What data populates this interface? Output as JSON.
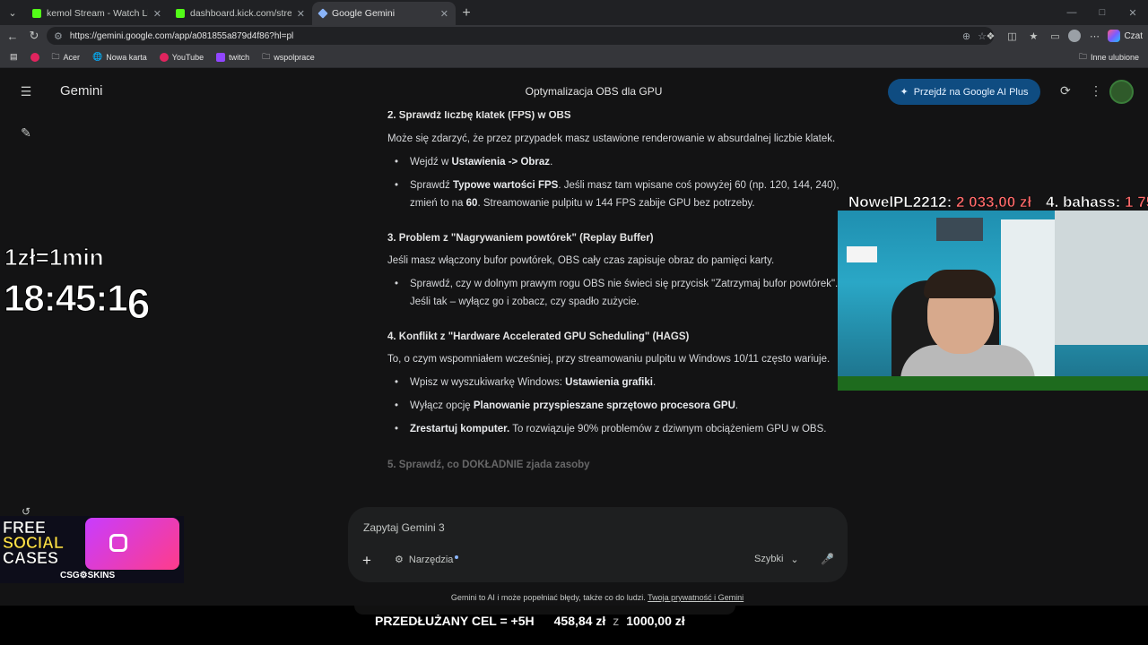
{
  "browser": {
    "tabs": [
      {
        "title": "kemol Stream - Watch Live on Kick",
        "favicon_color": "#53fc18"
      },
      {
        "title": "dashboard.kick.com/stream",
        "favicon_color": "#53fc18"
      },
      {
        "title": "Google Gemini",
        "favicon_color": "#8ab4f8"
      }
    ],
    "url": "https://gemini.google.com/app/a081855a879d4f86?hl=pl",
    "czat_label": "Czat",
    "bookmarks": [
      "Acer",
      "Nowa karta",
      "YouTube",
      "twitch",
      "wspolprace"
    ],
    "other_bookmarks": "Inne ulubione"
  },
  "gemini": {
    "brand": "Gemini",
    "chat_title": "Optymalizacja OBS dla GPU",
    "upgrade_label": "Przejdź na Google AI Plus",
    "content": {
      "sec2_title": "2. Sprawdź liczbę klatek (FPS) w OBS",
      "sec2_intro": "Może się zdarzyć, że przez przypadek masz ustawione renderowanie w absurdalnej liczbie klatek.",
      "sec2_b1_pre": "Wejdź w ",
      "sec2_b1_bold": "Ustawienia -> Obraz",
      "sec2_b1_post": ".",
      "sec2_b2_pre": "Sprawdź ",
      "sec2_b2_bold": "Typowe wartości FPS",
      "sec2_b2_mid": ". Jeśli masz tam wpisane coś powyżej 60 (np. 120, 144, 240), zmień to na ",
      "sec2_b2_bold2": "60",
      "sec2_b2_post": ". Streamowanie pulpitu w 144 FPS zabije GPU bez potrzeby.",
      "sec3_title": "3. Problem z \"Nagrywaniem powtórek\" (Replay Buffer)",
      "sec3_intro": "Jeśli masz włączony bufor powtórek, OBS cały czas zapisuje obraz do pamięci karty.",
      "sec3_b1": "Sprawdź, czy w dolnym prawym rogu OBS nie świeci się przycisk \"Zatrzymaj bufor powtórek\". Jeśli tak – wyłącz go i zobacz, czy spadło zużycie.",
      "sec4_title": "4. Konflikt z \"Hardware Accelerated GPU Scheduling\" (HAGS)",
      "sec4_intro": "To, o czym wspomniałem wcześniej, przy streamowaniu pulpitu w Windows 10/11 często wariuje.",
      "sec4_b1_pre": "Wpisz w wyszukiwarkę Windows: ",
      "sec4_b1_bold": "Ustawienia grafiki",
      "sec4_b1_post": ".",
      "sec4_b2_pre": "Wyłącz opcję ",
      "sec4_b2_bold": "Planowanie przyspieszane sprzętowo procesora GPU",
      "sec4_b2_post": ".",
      "sec4_b3_bold": "Zrestartuj komputer.",
      "sec4_b3_post": " To rozwiązuje 90% problemów z dziwnym obciążeniem GPU w OBS.",
      "sec5_title": "5. Sprawdź, co DOKŁADNIE zjada zasoby"
    },
    "composer": {
      "placeholder": "Zapytaj Gemini 3",
      "tools_label": "Narzędzia",
      "mode_label": "Szybki"
    },
    "disclaimer": "Gemini to AI i może popełniać błędy, także co do ludzi. ",
    "disclaimer_link": "Twoja prywatność i Gemini"
  },
  "overlay": {
    "rate": "1zł=1min",
    "timer_main": "18:45:1",
    "timer_last": "6",
    "tip1_name": "NowelPL2212:",
    "tip1_amount": "2 033,00 zł",
    "tip2_name": "4. bahass:",
    "tip2_amount": "1 75",
    "promo_line1": "FREE",
    "promo_line2": "SOCIAL",
    "promo_line3": "CASES",
    "promo_brand": "CSG⚙SKINS",
    "goal_label": "PRZEDŁUŻANY CEL = +5H",
    "goal_current": "458,84 zł",
    "goal_sep": "z",
    "goal_target": "1000,00 zł"
  }
}
